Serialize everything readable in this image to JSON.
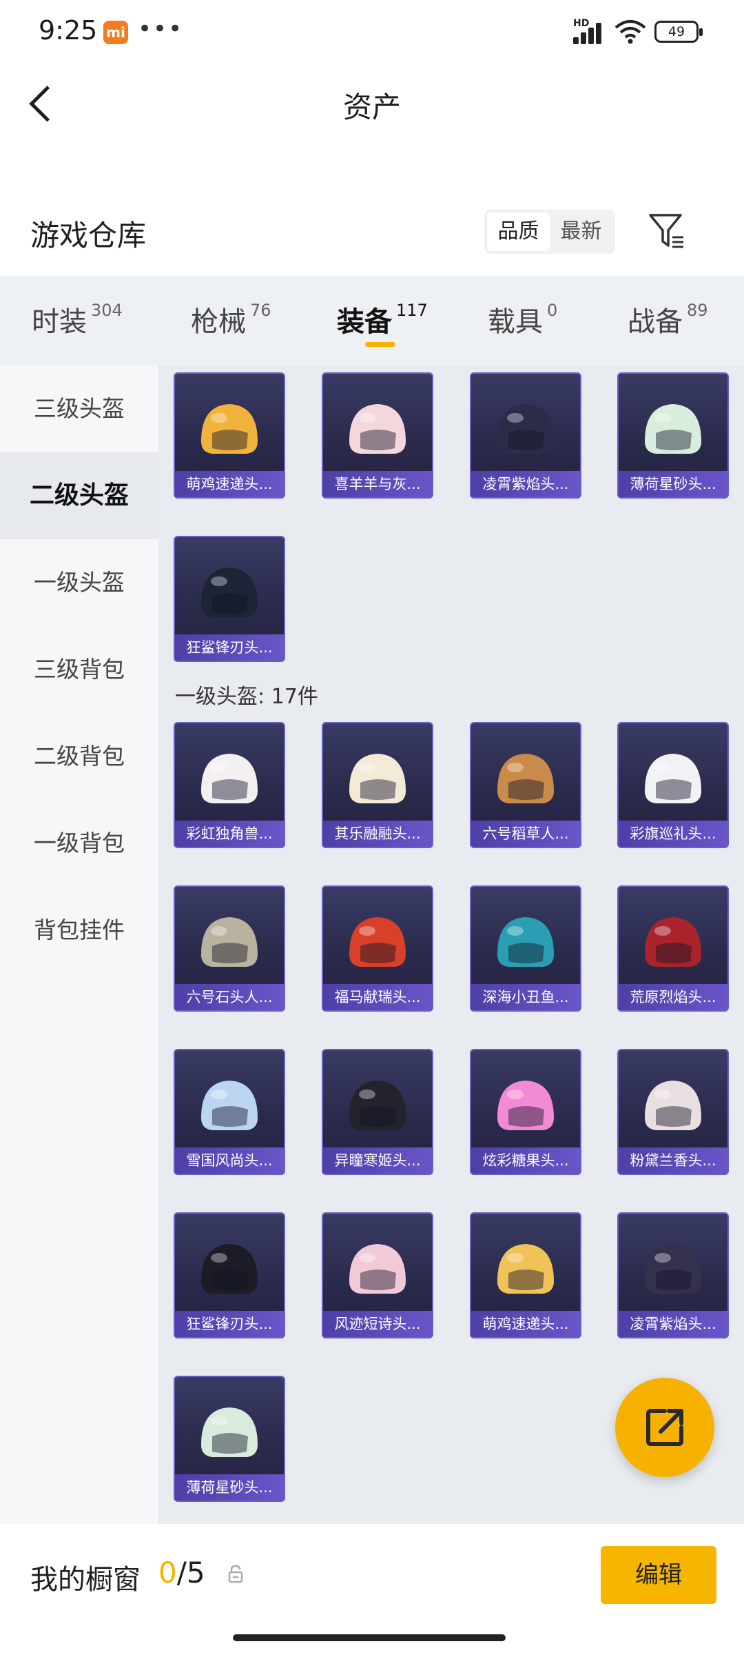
{
  "status_bar": {
    "time": "9:25",
    "app_badge": "mi",
    "more": "•••",
    "network": "HD",
    "battery": "49"
  },
  "header": {
    "title": "资产"
  },
  "warehouse": {
    "title": "游戏仓库",
    "sort_options": [
      "品质",
      "最新"
    ],
    "active_sort": "品质"
  },
  "tabs": [
    {
      "label": "时装",
      "count": "304"
    },
    {
      "label": "枪械",
      "count": "76"
    },
    {
      "label": "装备",
      "count": "117"
    },
    {
      "label": "载具",
      "count": "0"
    },
    {
      "label": "战备",
      "count": "89"
    }
  ],
  "sidebar": {
    "items": [
      "三级头盔",
      "二级头盔",
      "一级头盔",
      "三级背包",
      "二级背包",
      "一级背包",
      "背包挂件"
    ],
    "active": "二级头盔"
  },
  "sections": [
    {
      "title": "",
      "items": [
        "萌鸡速递头...",
        "喜羊羊与灰...",
        "凌霄紫焰头...",
        "薄荷星砂头...",
        "狂鲨锋刃头..."
      ]
    },
    {
      "title": "一级头盔: 17件",
      "items": [
        "彩虹独角兽...",
        "其乐融融头...",
        "六号稻草人...",
        "彩旗巡礼头...",
        "六号石头人...",
        "福马献瑞头...",
        "深海小丑鱼...",
        "荒原烈焰头...",
        "雪国风尚头...",
        "异瞳寒姬头...",
        "炫彩糖果头...",
        "粉黛兰香头...",
        "狂鲨锋刃头...",
        "风迹短诗头...",
        "萌鸡速递头...",
        "凌霄紫焰头...",
        "薄荷星砂头..."
      ]
    }
  ],
  "helmet_colors": [
    "#f2b33d",
    "#f4d7dc",
    "#2c2c4a",
    "#d9eddc",
    "#1c2436",
    "#f4f0f2",
    "#f3ead8",
    "#c98a4a",
    "#f1f1f6",
    "#b8b29e",
    "#d8402a",
    "#2a9fb3",
    "#a8232b",
    "#bcd6f2",
    "#22232b",
    "#f38ad6",
    "#eadfe0",
    "#1b1c24",
    "#f2c9d6",
    "#f0c257",
    "#34314f",
    "#d9ecdc"
  ],
  "bottom_bar": {
    "label": "我的橱窗",
    "current": "0",
    "total": "/5",
    "edit_label": "编辑"
  },
  "fab": {
    "icon": "share-external-icon"
  }
}
